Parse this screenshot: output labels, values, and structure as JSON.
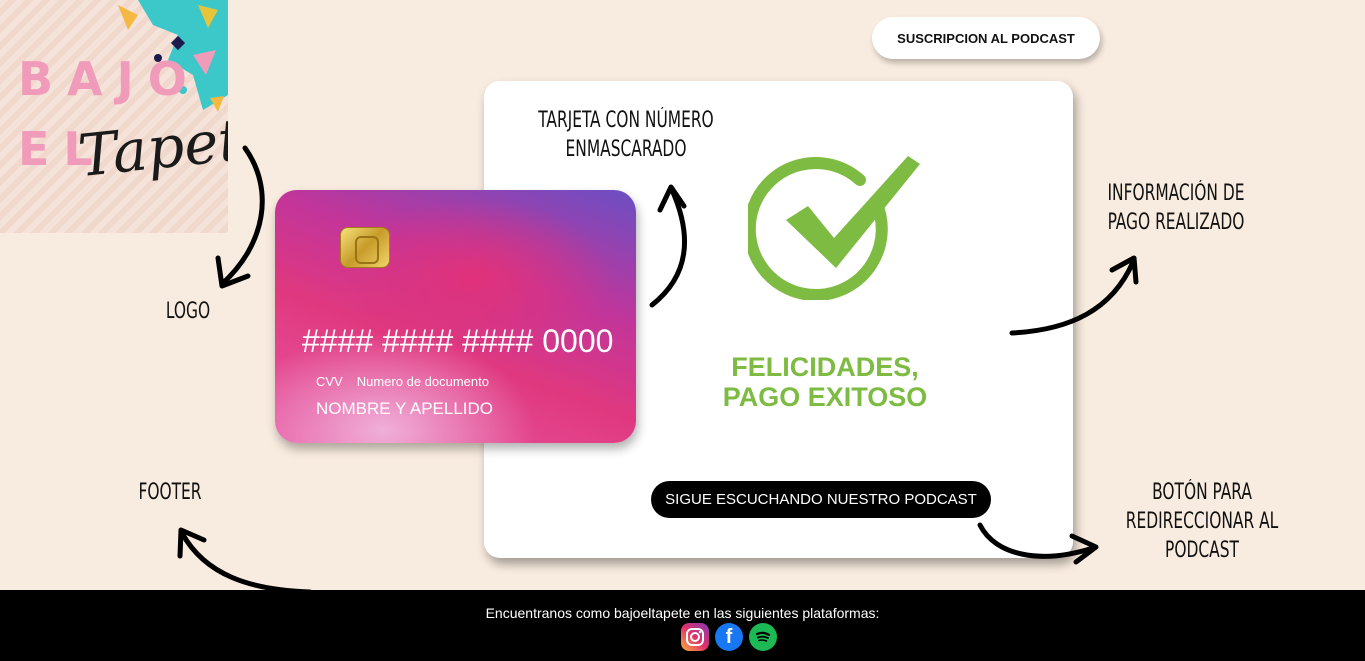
{
  "logo": {
    "line1": "BAJO",
    "line2": "EL",
    "script": "Tapete"
  },
  "annotations": {
    "logo": "LOGO",
    "footer": "FOOTER",
    "card": "TARJETA CON  NÚMERO\nENMASCARADO",
    "payment_info": "INFORMACIÓN DE\nPAGO REALIZADO",
    "redirect_button": "BOTÓN PARA\nREDIRECCIONAR AL\nPODCAST"
  },
  "header": {
    "subscribe_label": "SUSCRIPCION AL PODCAST"
  },
  "credit_card": {
    "number": "#### #### #### 0000",
    "cvv_label": "CVV",
    "document_label": "Numero de documento",
    "name_label": "NOMBRE Y APELLIDO"
  },
  "confirmation": {
    "icon": "check-circle-icon",
    "line1": "FELICIDADES,",
    "line2": "PAGO EXITOSO",
    "button_label": "SIGUE ESCUCHANDO NUESTRO PODCAST",
    "accent_color": "#7dbb42"
  },
  "footer": {
    "text": "Encuentranos como bajoeltapete en las siguientes plataformas:",
    "platforms": [
      "instagram-icon",
      "facebook-icon",
      "spotify-icon"
    ]
  }
}
